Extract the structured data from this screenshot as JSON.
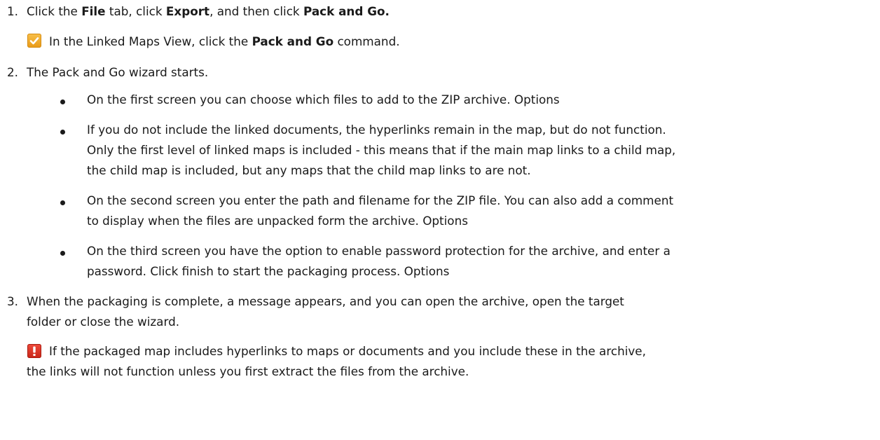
{
  "steps": [
    {
      "number": "1.",
      "parts": [
        "Click the ",
        "File",
        " tab, click ",
        "Export",
        ", and then click ",
        "Pack and Go."
      ]
    },
    {
      "tip": {
        "icon": "check-icon",
        "parts": [
          "In the Linked Maps View, click the ",
          "Pack and Go",
          " command."
        ]
      }
    },
    {
      "number": "2.",
      "text": "The Pack and Go wizard starts."
    },
    {
      "number": "3.",
      "lines": [
        "When the packaging is complete, a message appears, and you can open the archive, open the target",
        "folder or close the wizard."
      ]
    }
  ],
  "bullets": [
    {
      "lines": [
        "On the first screen you can choose which files to add to the ZIP archive.  Options"
      ]
    },
    {
      "lines": [
        "If you do not include the linked documents, the hyperlinks remain in the map, but do not function.",
        "Only the first level of linked maps is included - this means that if the main map links to a child map,",
        "the child map is included, but any maps that the child map links to are not."
      ]
    },
    {
      "lines": [
        "On the second screen you enter the path and filename for the ZIP file. You can also add a comment",
        "to display when the files are unpacked form the archive.  Options"
      ]
    },
    {
      "lines": [
        "On the third screen you have the option to enable password protection for the archive, and enter a",
        "password. Click finish to start the packaging process.  Options"
      ]
    }
  ],
  "warning": {
    "icon": "warning-icon",
    "lines": [
      "If the packaged map includes hyperlinks to maps or documents and you include these in the archive,",
      "the links will not function unless you first extract the files from the archive."
    ]
  }
}
